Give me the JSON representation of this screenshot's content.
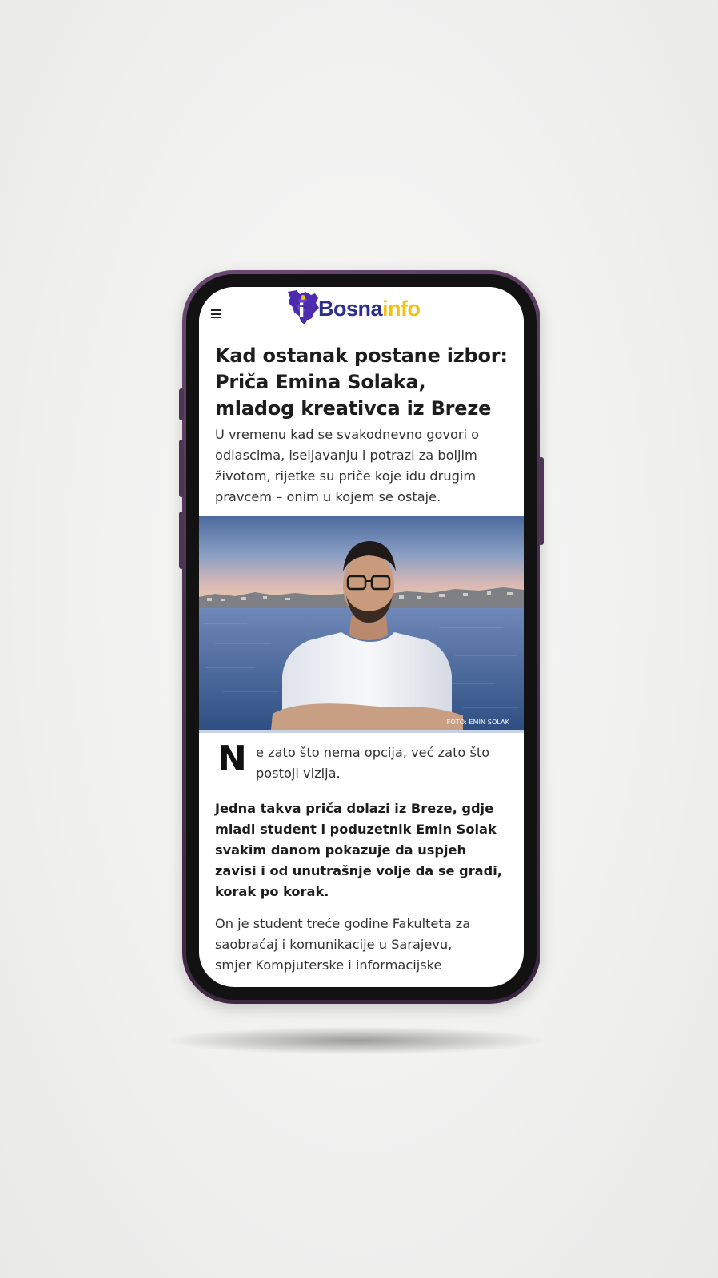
{
  "site": {
    "logo_part1": "Bosna",
    "logo_part2": "info",
    "logo_mark_letter": "i",
    "menu_icon": "hamburger-menu-icon",
    "brand_colors": {
      "primary": "#2b2f8f",
      "accent": "#f2c20c",
      "mark": "#4c2bb0"
    }
  },
  "article": {
    "headline_lines": [
      "Kad ostanak postane izbor:",
      "Priča Emina Solaka,",
      "mladog kreativca iz Breze"
    ],
    "lead_lines": [
      "U vremenu kad se svakodnevno govori o",
      "odlascima, iseljavanju i potrazi za boljim",
      "životom, rijetke su priče koje idu drugim",
      "pravcem – onim u kojem se ostaje."
    ],
    "photo_credit": "FOTO: EMIN SOLAK",
    "drop_cap": "N",
    "first_para_lines": [
      "e zato što nema opcija, već zato što",
      "postoji vizija."
    ],
    "bold_para_lines": [
      "Jedna takva priča dolazi iz Breze, gdje",
      "mladi student i poduzetnik Emin Solak",
      "svakim danom pokazuje da uspjeh",
      "zavisi i od unutrašnje volje da se gradi,",
      "korak po korak."
    ],
    "body_para_lines": [
      "On je student treće godine Fakulteta za",
      "saobraćaj i komunikacije u Sarajevu,",
      "smjer Kompjuterske i informacijske"
    ]
  }
}
